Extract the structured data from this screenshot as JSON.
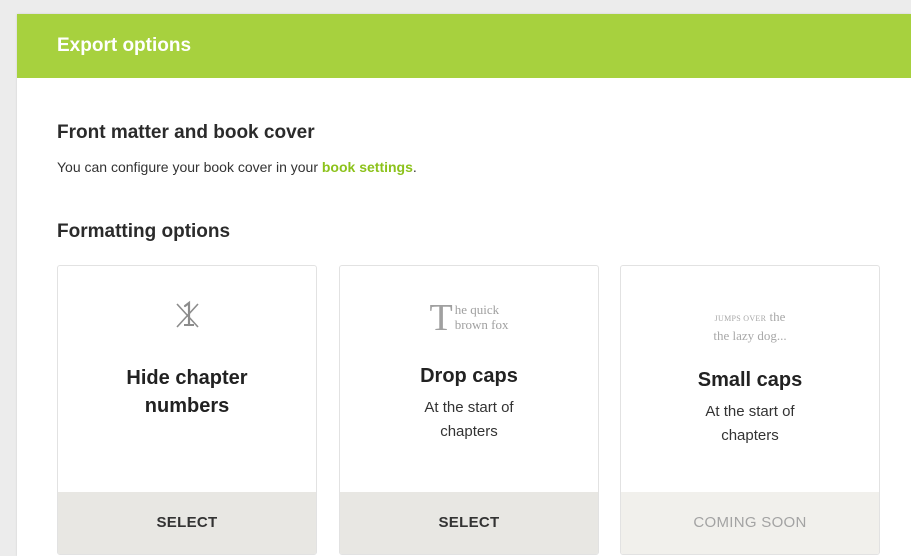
{
  "header": {
    "title": "Export options"
  },
  "front_matter": {
    "title": "Front matter and book cover",
    "text_before": "You can configure your book cover in your ",
    "link_label": "book settings",
    "text_after": "."
  },
  "formatting": {
    "title": "Formatting options",
    "cards": [
      {
        "icon": "crossed-number-icon",
        "title_line1": "Hide chapter",
        "title_line2": "numbers",
        "action": "SELECT"
      },
      {
        "icon": "drop-cap-preview",
        "preview_letter": "T",
        "preview_line1": "he quick",
        "preview_line2": "brown fox",
        "title": "Drop caps",
        "subtitle_line1": "At the start of",
        "subtitle_line2": "chapters",
        "action": "SELECT"
      },
      {
        "icon": "small-caps-preview",
        "preview_small": "JUMPS OVER",
        "preview_line1_rest": " the",
        "preview_line2": "the lazy dog...",
        "title": "Small caps",
        "subtitle_line1": "At the start of",
        "subtitle_line2": "chapters",
        "action": "COMING SOON"
      }
    ]
  },
  "colors": {
    "header_bg": "#a7d13e",
    "link": "#8cc21b",
    "footer_bg": "#e8e7e3"
  }
}
